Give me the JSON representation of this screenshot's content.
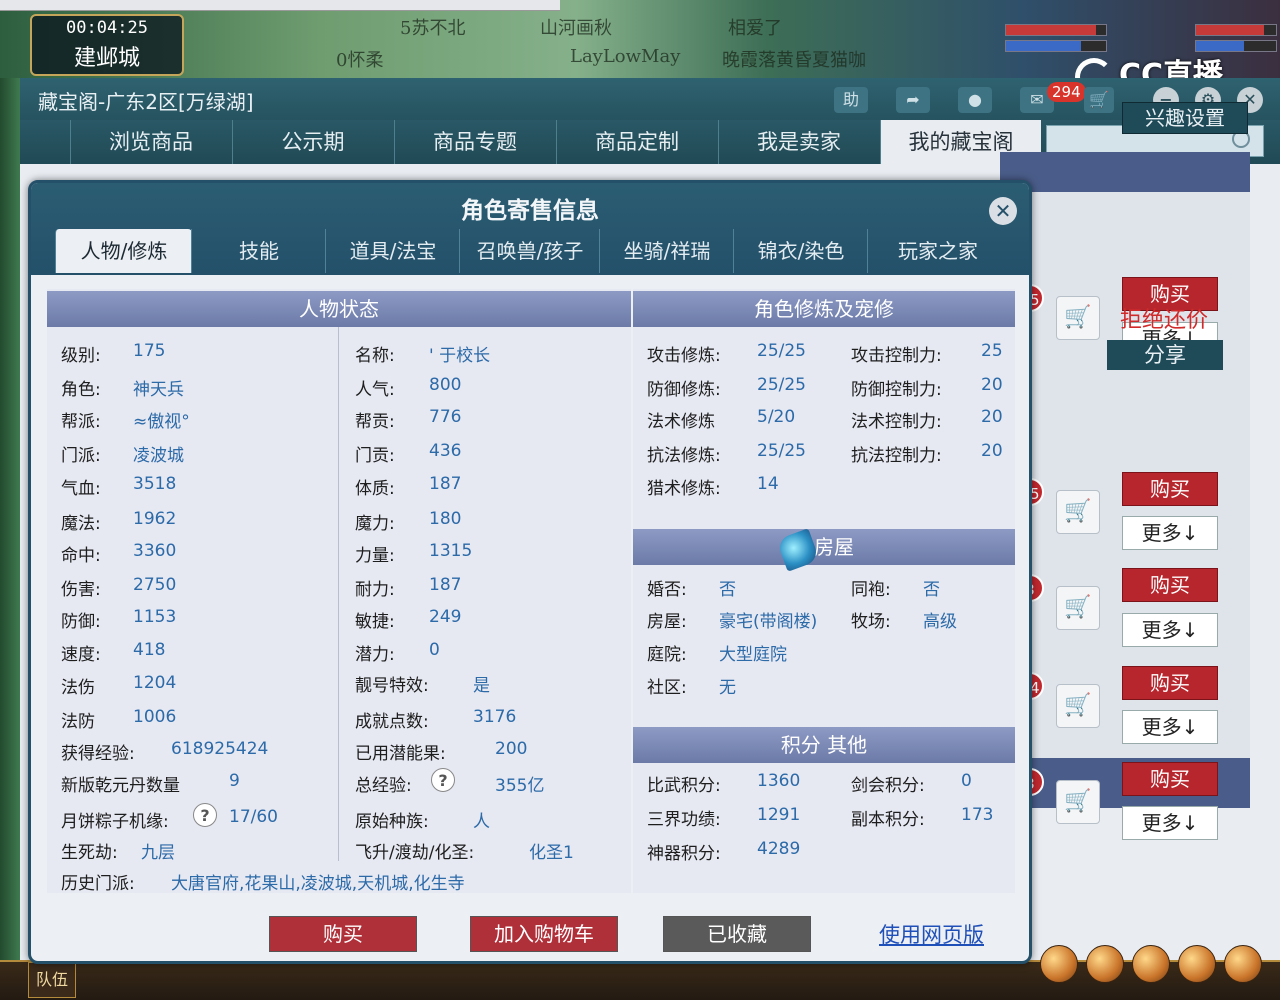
{
  "game": {
    "timer": "00:04:25",
    "city": "建邺城",
    "team_label": "队伍",
    "overlay_names": [
      "5苏不北",
      "山河画秋",
      "相爱了",
      "0怀柔",
      "LayLowMay",
      "晚霞落黄昏夏猫咖"
    ]
  },
  "stream_logo": "CC直播",
  "store": {
    "title": "藏宝阁-广东2区[万绿湖]",
    "help_label": "助",
    "cart_count": "294",
    "nav": [
      "浏览商品",
      "公示期",
      "商品专题",
      "商品定制",
      "我是卖家",
      "我的藏宝阁"
    ],
    "search_placeholder": "",
    "interest_label": "兴趣设置",
    "refuse_bargain": "拒绝还价",
    "share_label": "分享",
    "listing": [
      {
        "count": "15",
        "buy": "购买",
        "more": "更多↓"
      },
      {
        "count": "15",
        "buy": "购买",
        "more": "更多↓"
      },
      {
        "count": "3",
        "buy": "购买",
        "more": "更多↓"
      },
      {
        "count": "14",
        "buy": "购买",
        "more": "更多↓"
      },
      {
        "count": "3",
        "buy": "购买",
        "more": "更多↓"
      }
    ]
  },
  "dialog": {
    "title": "角色寄售信息",
    "tabs": [
      "人物/修炼",
      "技能",
      "道具/法宝",
      "召唤兽/孩子",
      "坐骑/祥瑞",
      "锦衣/染色",
      "玩家之家"
    ],
    "status": {
      "header": "人物状态",
      "left": [
        {
          "label": "级别:",
          "value": "175"
        },
        {
          "label": "角色:",
          "value": "神天兵"
        },
        {
          "label": "帮派:",
          "value": "≈傲视°"
        },
        {
          "label": "门派:",
          "value": "凌波城"
        },
        {
          "label": "气血:",
          "value": "3518"
        },
        {
          "label": "魔法:",
          "value": "1962"
        },
        {
          "label": "命中:",
          "value": "3360"
        },
        {
          "label": "伤害:",
          "value": "2750"
        },
        {
          "label": "防御:",
          "value": "1153"
        },
        {
          "label": "速度:",
          "value": "418"
        },
        {
          "label": "法伤",
          "value": "1204"
        },
        {
          "label": "法防",
          "value": "1006"
        },
        {
          "label": "获得经验:",
          "value": "618925424"
        },
        {
          "label": "新版乾元丹数量",
          "value": "9"
        },
        {
          "label": "月饼粽子机缘:",
          "value": "17/60"
        },
        {
          "label": "生死劫:",
          "value": "九层"
        }
      ],
      "right": [
        {
          "label": "名称:",
          "value": "' 于校长"
        },
        {
          "label": "人气:",
          "value": "800"
        },
        {
          "label": "帮贡:",
          "value": "776"
        },
        {
          "label": "门贡:",
          "value": "436"
        },
        {
          "label": "体质:",
          "value": "187"
        },
        {
          "label": "魔力:",
          "value": "180"
        },
        {
          "label": "力量:",
          "value": "1315"
        },
        {
          "label": "耐力:",
          "value": "187"
        },
        {
          "label": "敏捷:",
          "value": "249"
        },
        {
          "label": "潜力:",
          "value": "0"
        },
        {
          "label": "靓号特效:",
          "value": "是"
        },
        {
          "label": "成就点数:",
          "value": "3176"
        },
        {
          "label": "已用潜能果:",
          "value": "200"
        },
        {
          "label": "总经验:",
          "value": "355亿"
        },
        {
          "label": "原始种族:",
          "value": "人"
        },
        {
          "label": "飞升/渡劫/化圣:",
          "value": "化圣1"
        }
      ],
      "history": {
        "label": "历史门派:",
        "value": "大唐官府,花果山,凌波城,天机城,化生寺"
      }
    },
    "cultivation": {
      "header": "角色修炼及宠修",
      "rows": [
        [
          {
            "label": "攻击修炼:",
            "value": "25/25"
          },
          {
            "label": "攻击控制力:",
            "value": "25"
          }
        ],
        [
          {
            "label": "防御修炼:",
            "value": "25/25"
          },
          {
            "label": "防御控制力:",
            "value": "20"
          }
        ],
        [
          {
            "label": "法术修炼",
            "value": "5/20"
          },
          {
            "label": "法术控制力:",
            "value": "20"
          }
        ],
        [
          {
            "label": "抗法修炼:",
            "value": "25/25"
          },
          {
            "label": "抗法控制力:",
            "value": "20"
          }
        ],
        [
          {
            "label": "猎术修炼:",
            "value": "14"
          },
          {
            "label": "",
            "value": ""
          }
        ]
      ]
    },
    "house": {
      "header": "住房屋",
      "rows": [
        [
          {
            "label": "婚否:",
            "value": "否"
          },
          {
            "label": "同袍:",
            "value": "否"
          }
        ],
        [
          {
            "label": "房屋:",
            "value": "豪宅(带阁楼)"
          },
          {
            "label": "牧场:",
            "value": "高级"
          }
        ],
        [
          {
            "label": "庭院:",
            "value": "大型庭院"
          },
          {
            "label": "",
            "value": ""
          }
        ],
        [
          {
            "label": "社区:",
            "value": "无"
          },
          {
            "label": "",
            "value": ""
          }
        ]
      ]
    },
    "points": {
      "header": "积分 其他",
      "rows": [
        [
          {
            "label": "比武积分:",
            "value": "1360"
          },
          {
            "label": "剑会积分:",
            "value": "0"
          }
        ],
        [
          {
            "label": "三界功绩:",
            "value": "1291"
          },
          {
            "label": "副本积分:",
            "value": "173"
          }
        ],
        [
          {
            "label": "神器积分:",
            "value": "4289"
          },
          {
            "label": "",
            "value": ""
          }
        ]
      ]
    },
    "actions": {
      "buy": "购买",
      "add_cart": "加入购物车",
      "collected": "已收藏",
      "web_version": "使用网页版"
    }
  }
}
